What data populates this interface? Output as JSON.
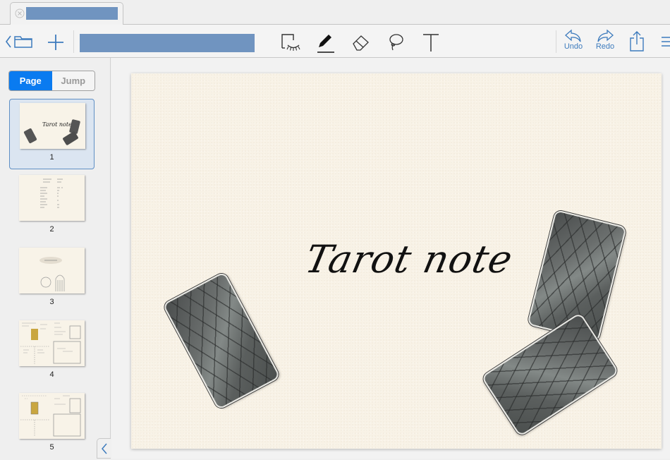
{
  "tab": {
    "title": "",
    "close_icon": "close-circle-icon"
  },
  "toolbar": {
    "back_icon": "chevron-left-icon",
    "folder_icon": "folder-icon",
    "add_icon": "plus-icon",
    "title_field_value": "",
    "tools": [
      {
        "name": "selection-tool",
        "icon": "eye-selection-icon"
      },
      {
        "name": "pen-tool",
        "icon": "pen-icon",
        "active": true
      },
      {
        "name": "eraser-tool",
        "icon": "eraser-icon"
      },
      {
        "name": "lasso-tool",
        "icon": "lasso-icon"
      },
      {
        "name": "text-tool",
        "icon": "text-T-icon"
      }
    ],
    "undo_label": "Undo",
    "redo_label": "Redo",
    "share_icon": "share-icon",
    "menu_icon": "menu-icon"
  },
  "sidebar": {
    "segments": [
      {
        "label": "Page",
        "active": true
      },
      {
        "label": "Jump",
        "active": false
      }
    ],
    "pages": [
      {
        "number": "1",
        "selected": true
      },
      {
        "number": "2",
        "selected": false
      },
      {
        "number": "3",
        "selected": false
      },
      {
        "number": "4",
        "selected": false
      },
      {
        "number": "5",
        "selected": false
      }
    ],
    "collapse_icon": "chevron-left-icon"
  },
  "canvas": {
    "title_text": "Tarot note",
    "thumb_title_text": "Tarot note"
  },
  "colors": {
    "accent": "#0a7bf0",
    "toolbar_icon": "#3d7bbd",
    "page_background": "#f8f2e6"
  }
}
